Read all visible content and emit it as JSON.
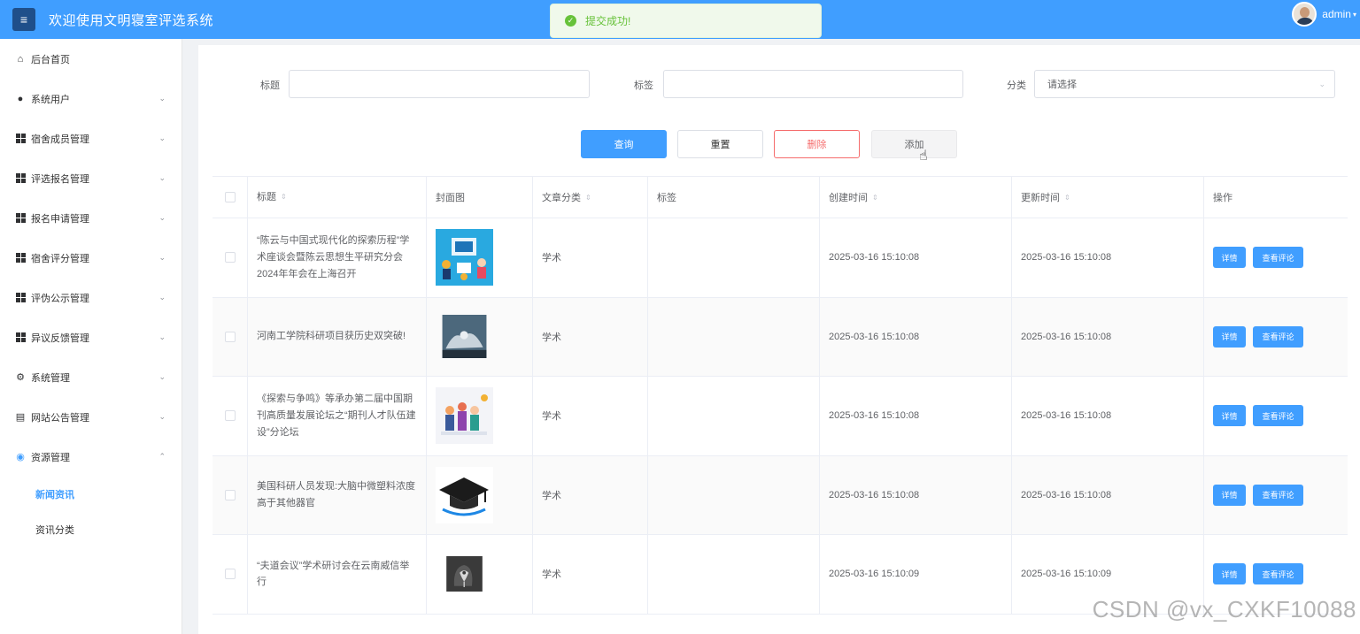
{
  "header": {
    "title": "欢迎使用文明寝室评选系统",
    "user": "admin",
    "toast": "提交成功!"
  },
  "sidebar": {
    "items": [
      {
        "label": "后台首页",
        "icon": "home-icon"
      },
      {
        "label": "系统用户",
        "icon": "user-icon"
      },
      {
        "label": "宿舍成员管理",
        "icon": "grid-icon"
      },
      {
        "label": "评选报名管理",
        "icon": "grid-icon"
      },
      {
        "label": "报名申请管理",
        "icon": "grid-icon"
      },
      {
        "label": "宿舍评分管理",
        "icon": "grid-icon"
      },
      {
        "label": "评伪公示管理",
        "icon": "grid-icon"
      },
      {
        "label": "异议反馈管理",
        "icon": "grid-icon"
      },
      {
        "label": "系统管理",
        "icon": "gear-icon"
      },
      {
        "label": "网站公告管理",
        "icon": "document-icon"
      },
      {
        "label": "资源管理",
        "icon": "info-icon"
      }
    ],
    "sub_items": [
      {
        "label": "新闻资讯"
      },
      {
        "label": "资讯分类"
      }
    ]
  },
  "filters": {
    "title_label": "标题",
    "title_value": "",
    "tag_label": "标签",
    "tag_value": "",
    "category_label": "分类",
    "category_placeholder": "请选择"
  },
  "buttons": {
    "query": "查询",
    "reset": "重置",
    "delete": "删除",
    "add": "添加"
  },
  "table": {
    "columns": [
      "标题",
      "封面图",
      "文章分类",
      "标签",
      "创建时间",
      "更新时间",
      "操作"
    ],
    "detail_label": "详情",
    "comments_label": "查看评论",
    "rows": [
      {
        "title": "“陈云与中国式现代化的探索历程”学术座谈会暨陈云思想生平研究分会2024年年会在上海召开",
        "category": "学术",
        "tag": "",
        "created": "2025-03-16 15:10:08",
        "updated": "2025-03-16 15:10:08"
      },
      {
        "title": "河南工学院科研项目获历史双突破!",
        "category": "学术",
        "tag": "",
        "created": "2025-03-16 15:10:08",
        "updated": "2025-03-16 15:10:08"
      },
      {
        "title": "《探索与争鸣》等承办第二届中国期刊高质量发展论坛之“期刊人才队伍建设”分论坛",
        "category": "学术",
        "tag": "",
        "created": "2025-03-16 15:10:08",
        "updated": "2025-03-16 15:10:08"
      },
      {
        "title": "美国科研人员发现:大脑中微塑料浓度高于其他器官",
        "category": "学术",
        "tag": "",
        "created": "2025-03-16 15:10:08",
        "updated": "2025-03-16 15:10:08"
      },
      {
        "title": "“夫道会议”学术研讨会在云南威信举行",
        "category": "学术",
        "tag": "",
        "created": "2025-03-16 15:10:09",
        "updated": "2025-03-16 15:10:09"
      }
    ]
  },
  "watermark": "CSDN @vx_CXKF10088",
  "colors": {
    "primary": "#409eff",
    "danger": "#f56c6c",
    "success": "#67c23a"
  }
}
